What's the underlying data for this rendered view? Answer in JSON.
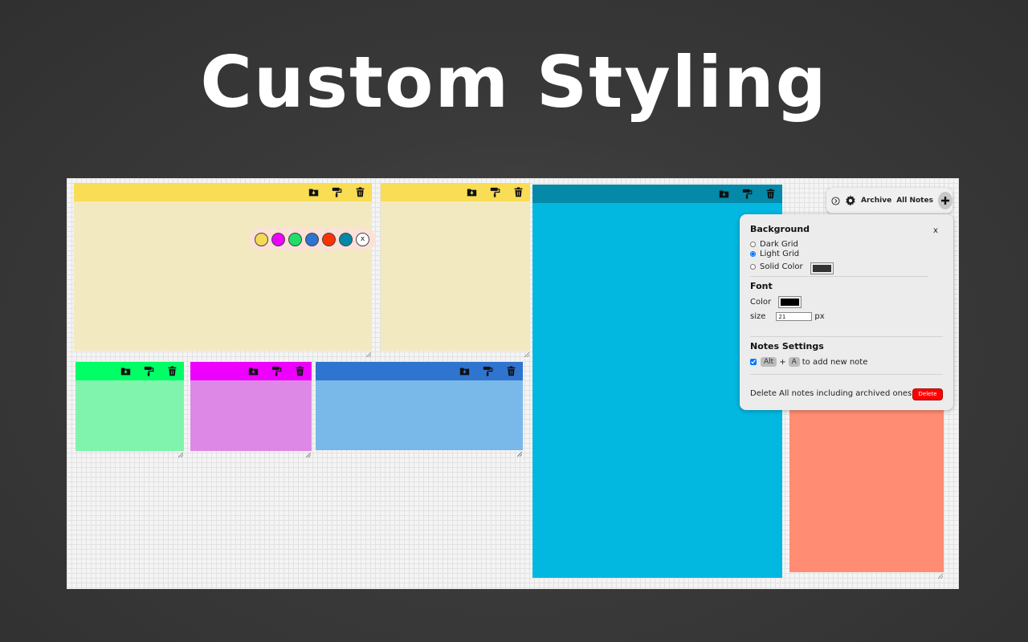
{
  "headline": "Custom Styling",
  "colors": {
    "yellow_header": "#f9dd55",
    "yellow_body": "#f3e9c0",
    "green_header": "#00ff66",
    "green_body": "#80f4ad",
    "magenta_header": "#ee00ff",
    "magenta_body": "#dd88e6",
    "blue_header": "#2f74cf",
    "blue_body": "#78b9e9",
    "teal_header": "#0489a8",
    "teal_body": "#02b8e1",
    "salmon_body": "#ff8c73",
    "delete_button": "#ff0000"
  },
  "note_tools": {
    "archive": "archive-icon",
    "style": "paint-roller-icon",
    "delete": "trash-icon"
  },
  "palette": {
    "swatches": [
      "#f4da57",
      "#ee00ff",
      "#22dd66",
      "#2f74cf",
      "#ff3300",
      "#0489a8"
    ],
    "close_label": "x"
  },
  "topbar": {
    "icons": [
      "circle-arrow-icon",
      "gear-icon",
      "plus-icon"
    ],
    "archive_label": "Archive",
    "all_notes_label": "All Notes"
  },
  "settings": {
    "close_label": "x",
    "background": {
      "heading": "Background",
      "options": [
        "Dark Grid",
        "Light Grid",
        "Solid Color"
      ],
      "selected": "Light Grid",
      "solid_color": "#333333"
    },
    "font": {
      "heading": "Font",
      "color_label": "Color",
      "color_value": "#000000",
      "size_label": "size",
      "size_value": "21",
      "size_unit": "px"
    },
    "notes_settings": {
      "heading": "Notes Settings",
      "shortcut_enabled": true,
      "key1": "Alt",
      "plus": "+",
      "key2": "A",
      "shortcut_text": "to add new note"
    },
    "delete_all_text": "Delete All notes including archived ones",
    "delete_button_label": "Delete"
  }
}
